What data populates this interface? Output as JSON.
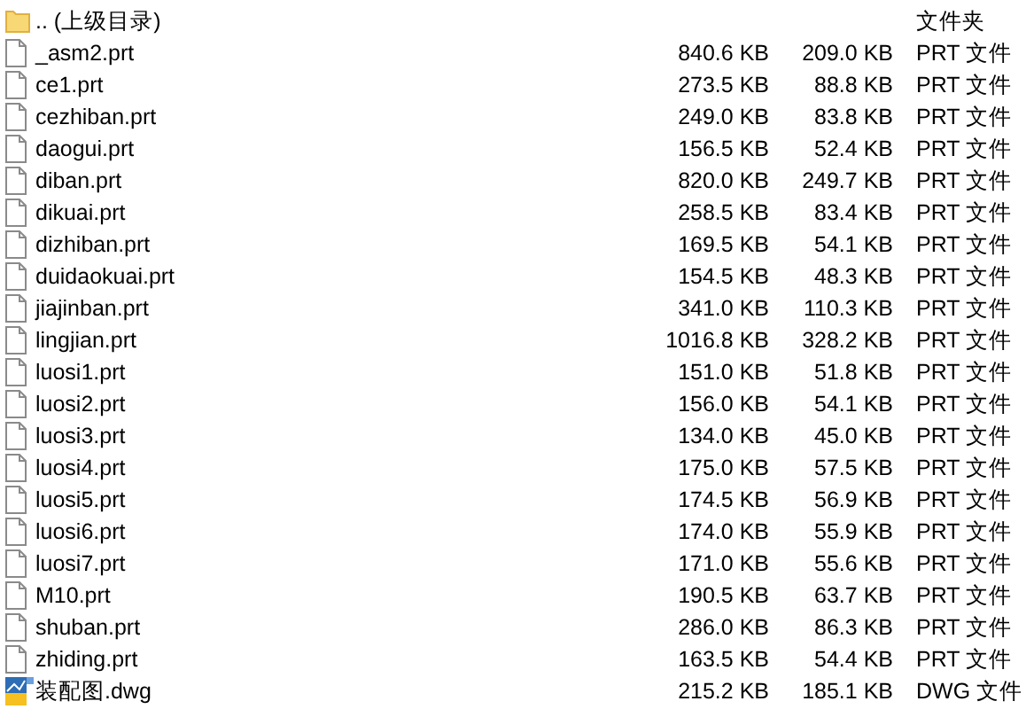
{
  "files": [
    {
      "kind": "folder",
      "name": ".. (上级目录)",
      "type": "文件夹"
    },
    {
      "kind": "file",
      "name": "_asm2.prt",
      "size": "840.6 KB",
      "packed": "209.0 KB",
      "type": "PRT 文件"
    },
    {
      "kind": "file",
      "name": "ce1.prt",
      "size": "273.5 KB",
      "packed": "88.8 KB",
      "type": "PRT 文件"
    },
    {
      "kind": "file",
      "name": "cezhiban.prt",
      "size": "249.0 KB",
      "packed": "83.8 KB",
      "type": "PRT 文件"
    },
    {
      "kind": "file",
      "name": "daogui.prt",
      "size": "156.5 KB",
      "packed": "52.4 KB",
      "type": "PRT 文件"
    },
    {
      "kind": "file",
      "name": "diban.prt",
      "size": "820.0 KB",
      "packed": "249.7 KB",
      "type": "PRT 文件"
    },
    {
      "kind": "file",
      "name": "dikuai.prt",
      "size": "258.5 KB",
      "packed": "83.4 KB",
      "type": "PRT 文件"
    },
    {
      "kind": "file",
      "name": "dizhiban.prt",
      "size": "169.5 KB",
      "packed": "54.1 KB",
      "type": "PRT 文件"
    },
    {
      "kind": "file",
      "name": "duidaokuai.prt",
      "size": "154.5 KB",
      "packed": "48.3 KB",
      "type": "PRT 文件"
    },
    {
      "kind": "file",
      "name": "jiajinban.prt",
      "size": "341.0 KB",
      "packed": "110.3 KB",
      "type": "PRT 文件"
    },
    {
      "kind": "file",
      "name": "lingjian.prt",
      "size": "1016.8 KB",
      "packed": "328.2 KB",
      "type": "PRT 文件"
    },
    {
      "kind": "file",
      "name": "luosi1.prt",
      "size": "151.0 KB",
      "packed": "51.8 KB",
      "type": "PRT 文件"
    },
    {
      "kind": "file",
      "name": "luosi2.prt",
      "size": "156.0 KB",
      "packed": "54.1 KB",
      "type": "PRT 文件"
    },
    {
      "kind": "file",
      "name": "luosi3.prt",
      "size": "134.0 KB",
      "packed": "45.0 KB",
      "type": "PRT 文件"
    },
    {
      "kind": "file",
      "name": "luosi4.prt",
      "size": "175.0 KB",
      "packed": "57.5 KB",
      "type": "PRT 文件"
    },
    {
      "kind": "file",
      "name": "luosi5.prt",
      "size": "174.5 KB",
      "packed": "56.9 KB",
      "type": "PRT 文件"
    },
    {
      "kind": "file",
      "name": "luosi6.prt",
      "size": "174.0 KB",
      "packed": "55.9 KB",
      "type": "PRT 文件"
    },
    {
      "kind": "file",
      "name": "luosi7.prt",
      "size": "171.0 KB",
      "packed": "55.6 KB",
      "type": "PRT 文件"
    },
    {
      "kind": "file",
      "name": "M10.prt",
      "size": "190.5 KB",
      "packed": "63.7 KB",
      "type": "PRT 文件"
    },
    {
      "kind": "file",
      "name": "shuban.prt",
      "size": "286.0 KB",
      "packed": "86.3 KB",
      "type": "PRT 文件"
    },
    {
      "kind": "file",
      "name": "zhiding.prt",
      "size": "163.5 KB",
      "packed": "54.4 KB",
      "type": "PRT 文件"
    },
    {
      "kind": "drawing",
      "name": "装配图.dwg",
      "size": "215.2 KB",
      "packed": "185.1 KB",
      "type": "DWG 文件"
    }
  ]
}
